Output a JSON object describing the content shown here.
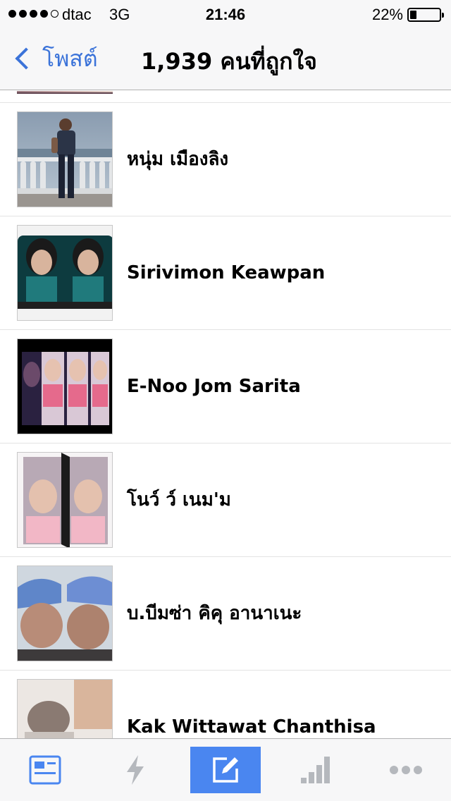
{
  "status_bar": {
    "carrier": "dtac",
    "network": "3G",
    "time": "21:46",
    "battery_percent": "22%",
    "battery_level": 0.22,
    "signal_bars": 4
  },
  "nav": {
    "back_label": "โพสต์",
    "title": "1,939 คนที่ถูกใจ"
  },
  "likers": [
    {
      "name": "หนุ่ม เมืองลิง"
    },
    {
      "name": "Sirivimon Keawpan"
    },
    {
      "name": "E-Noo Jom Sarita"
    },
    {
      "name": "โนว์ ว์ เนม'ม"
    },
    {
      "name": "บ.บีมซ่า คิคุ อานาเนะ"
    },
    {
      "name": "Kak Wittawat Chanthisa"
    }
  ],
  "tab_bar": {
    "tabs": [
      {
        "icon": "news-feed-icon",
        "active": false
      },
      {
        "icon": "notifications-icon",
        "active": false
      },
      {
        "icon": "compose-icon",
        "active": true
      },
      {
        "icon": "stats-icon",
        "active": false
      },
      {
        "icon": "more-icon",
        "active": false
      }
    ]
  },
  "colors": {
    "accent": "#4a86f0",
    "link": "#3b73d9",
    "bar_bg": "#f7f7f8",
    "inactive_icon": "#b5b8bd"
  }
}
